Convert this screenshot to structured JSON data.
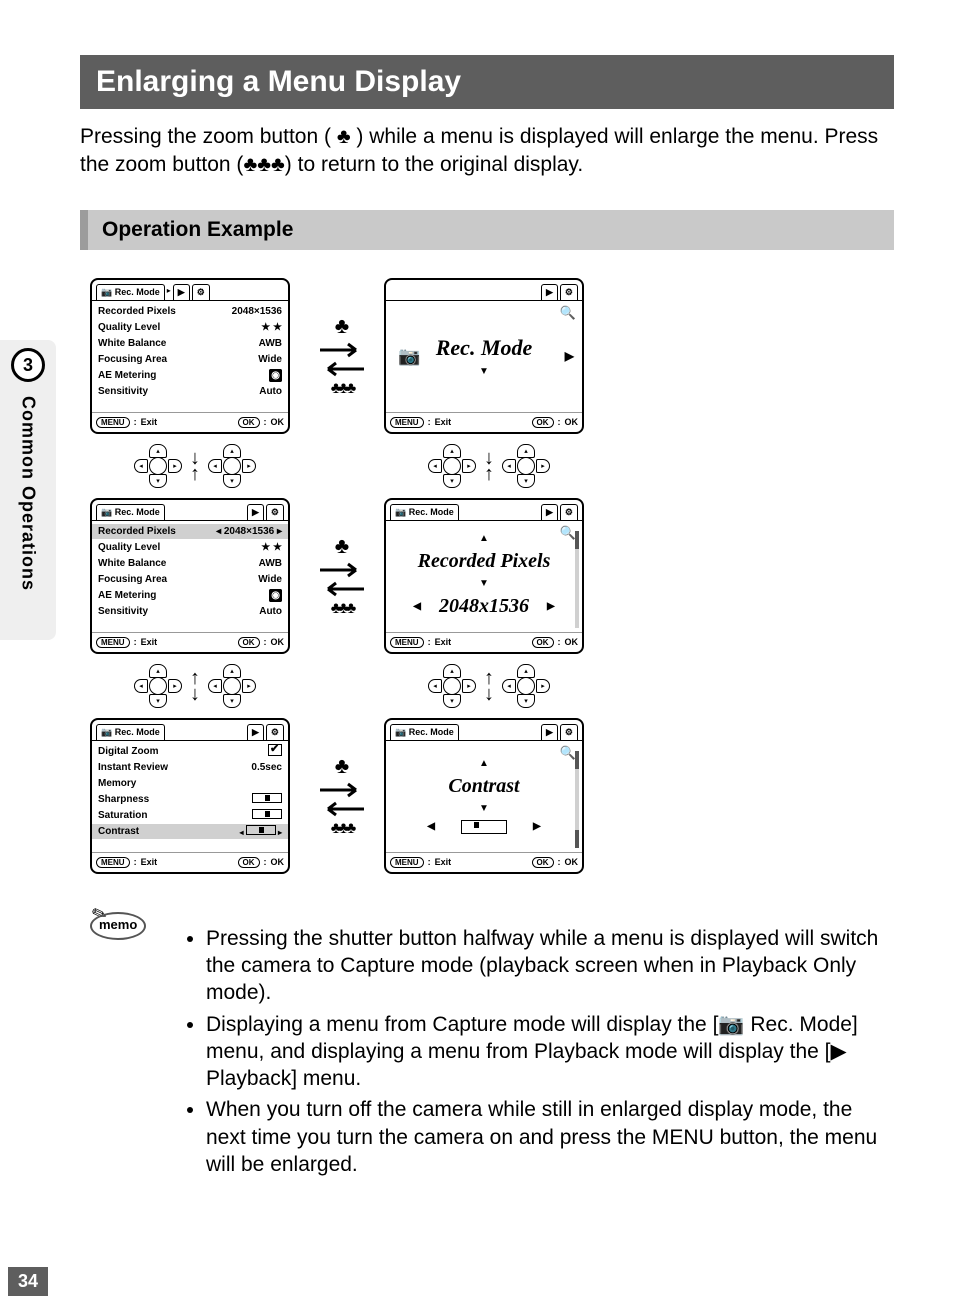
{
  "title": "Enlarging a Menu Display",
  "intro_a": "Pressing the zoom button ( ",
  "intro_b": " ) while a menu is displayed will enlarge the menu. Press the zoom button (",
  "intro_c": ") to return to the original display.",
  "subheading": "Operation Example",
  "side": {
    "chapter": "3",
    "label": "Common Operations"
  },
  "page_number": "34",
  "tabs": {
    "rec": "Rec. Mode"
  },
  "footer": {
    "menu_badge": "MENU",
    "exit": "Exit",
    "ok_badge": "OK",
    "ok": "OK"
  },
  "screen1": {
    "rows": [
      {
        "label": "Recorded Pixels",
        "value": "2048×1536"
      },
      {
        "label": "Quality Level",
        "value": "★ ★"
      },
      {
        "label": "White Balance",
        "value": "AWB"
      },
      {
        "label": "Focusing Area",
        "value": "Wide"
      },
      {
        "label": "AE Metering",
        "value": "",
        "meter": true
      },
      {
        "label": "Sensitivity",
        "value": "Auto"
      }
    ]
  },
  "screen2": {
    "title": "Rec. Mode"
  },
  "screen3": {
    "rows": [
      {
        "label": "Recorded Pixels",
        "value": "2048×1536",
        "hl": true,
        "lr": true
      },
      {
        "label": "Quality Level",
        "value": "★ ★"
      },
      {
        "label": "White Balance",
        "value": "AWB"
      },
      {
        "label": "Focusing Area",
        "value": "Wide"
      },
      {
        "label": "AE Metering",
        "value": "",
        "meter": true
      },
      {
        "label": "Sensitivity",
        "value": "Auto"
      }
    ]
  },
  "screen4": {
    "title": "Recorded Pixels",
    "value": "2048x1536"
  },
  "screen5": {
    "rows": [
      {
        "label": "Digital Zoom",
        "value": "",
        "check": true
      },
      {
        "label": "Instant Review",
        "value": "0.5sec"
      },
      {
        "label": "Memory",
        "value": ""
      },
      {
        "label": "Sharpness",
        "value": "",
        "slider": true
      },
      {
        "label": "Saturation",
        "value": "",
        "slider": true
      },
      {
        "label": "Contrast",
        "value": "",
        "slider": true,
        "hl": true,
        "lr": true
      }
    ]
  },
  "screen6": {
    "title": "Contrast"
  },
  "memo_label": "memo",
  "memo": [
    "Pressing the shutter button halfway while a menu is displayed will switch the camera to Capture mode (playback screen when in Playback Only mode).",
    "Displaying a menu from Capture mode will display the [📷 Rec. Mode] menu, and displaying a menu from Playback mode will display the [▶ Playback] menu.",
    "When you turn off the camera while still in enlarged display mode, the next time you turn the camera on and press the MENU button, the menu will be enlarged."
  ]
}
